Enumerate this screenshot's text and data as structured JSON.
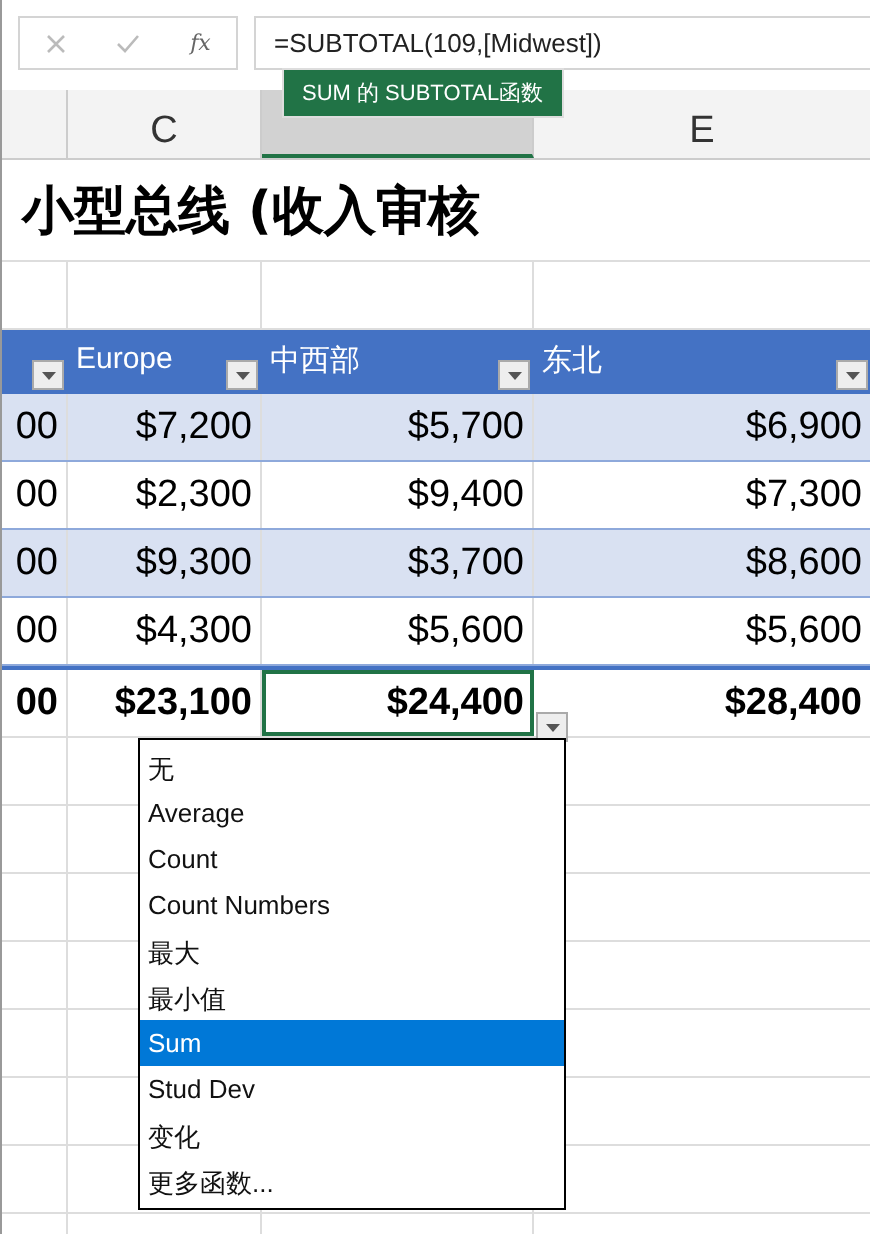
{
  "formula_bar": {
    "function_label": "fx",
    "formula": "=SUBTOTAL(109,[Midwest])"
  },
  "tooltip": "SUM 的 SUBTOTAL函数",
  "column_headers": [
    {
      "selected": false
    },
    {
      "label": "C",
      "selected": false
    },
    {
      "selected": true
    },
    {
      "label": "E",
      "selected": false
    }
  ],
  "title": "小型总线 (收入审核",
  "table": {
    "columns": [
      {},
      {
        "label": "Europe"
      },
      {
        "label": "中西部"
      },
      {
        "label": "东北"
      }
    ],
    "rows": [
      [
        "00",
        "$7,200",
        "$5,700",
        "$6,900"
      ],
      [
        "00",
        "$2,300",
        "$9,400",
        "$7,300"
      ],
      [
        "00",
        "$9,300",
        "$3,700",
        "$8,600"
      ],
      [
        "00",
        "$4,300",
        "$5,600",
        "$5,600"
      ]
    ],
    "total_row": [
      {
        "value": "00",
        "selected": false
      },
      {
        "value": "$23,100",
        "selected": false
      },
      {
        "value": "$24,400",
        "selected": true
      },
      {
        "value": "$28,400",
        "selected": false
      }
    ]
  },
  "dropdown": [
    {
      "label": "无",
      "selected": false
    },
    {
      "label": "Average",
      "selected": false
    },
    {
      "label": "Count",
      "selected": false
    },
    {
      "label": "Count Numbers",
      "selected": false
    },
    {
      "label": "最大",
      "selected": false
    },
    {
      "label": "最小值",
      "selected": false
    },
    {
      "label": "Sum",
      "selected": true
    },
    {
      "label": "Stud Dev",
      "selected": false
    },
    {
      "label": "变化",
      "selected": false
    },
    {
      "label": "更多函数...",
      "selected": false
    }
  ]
}
